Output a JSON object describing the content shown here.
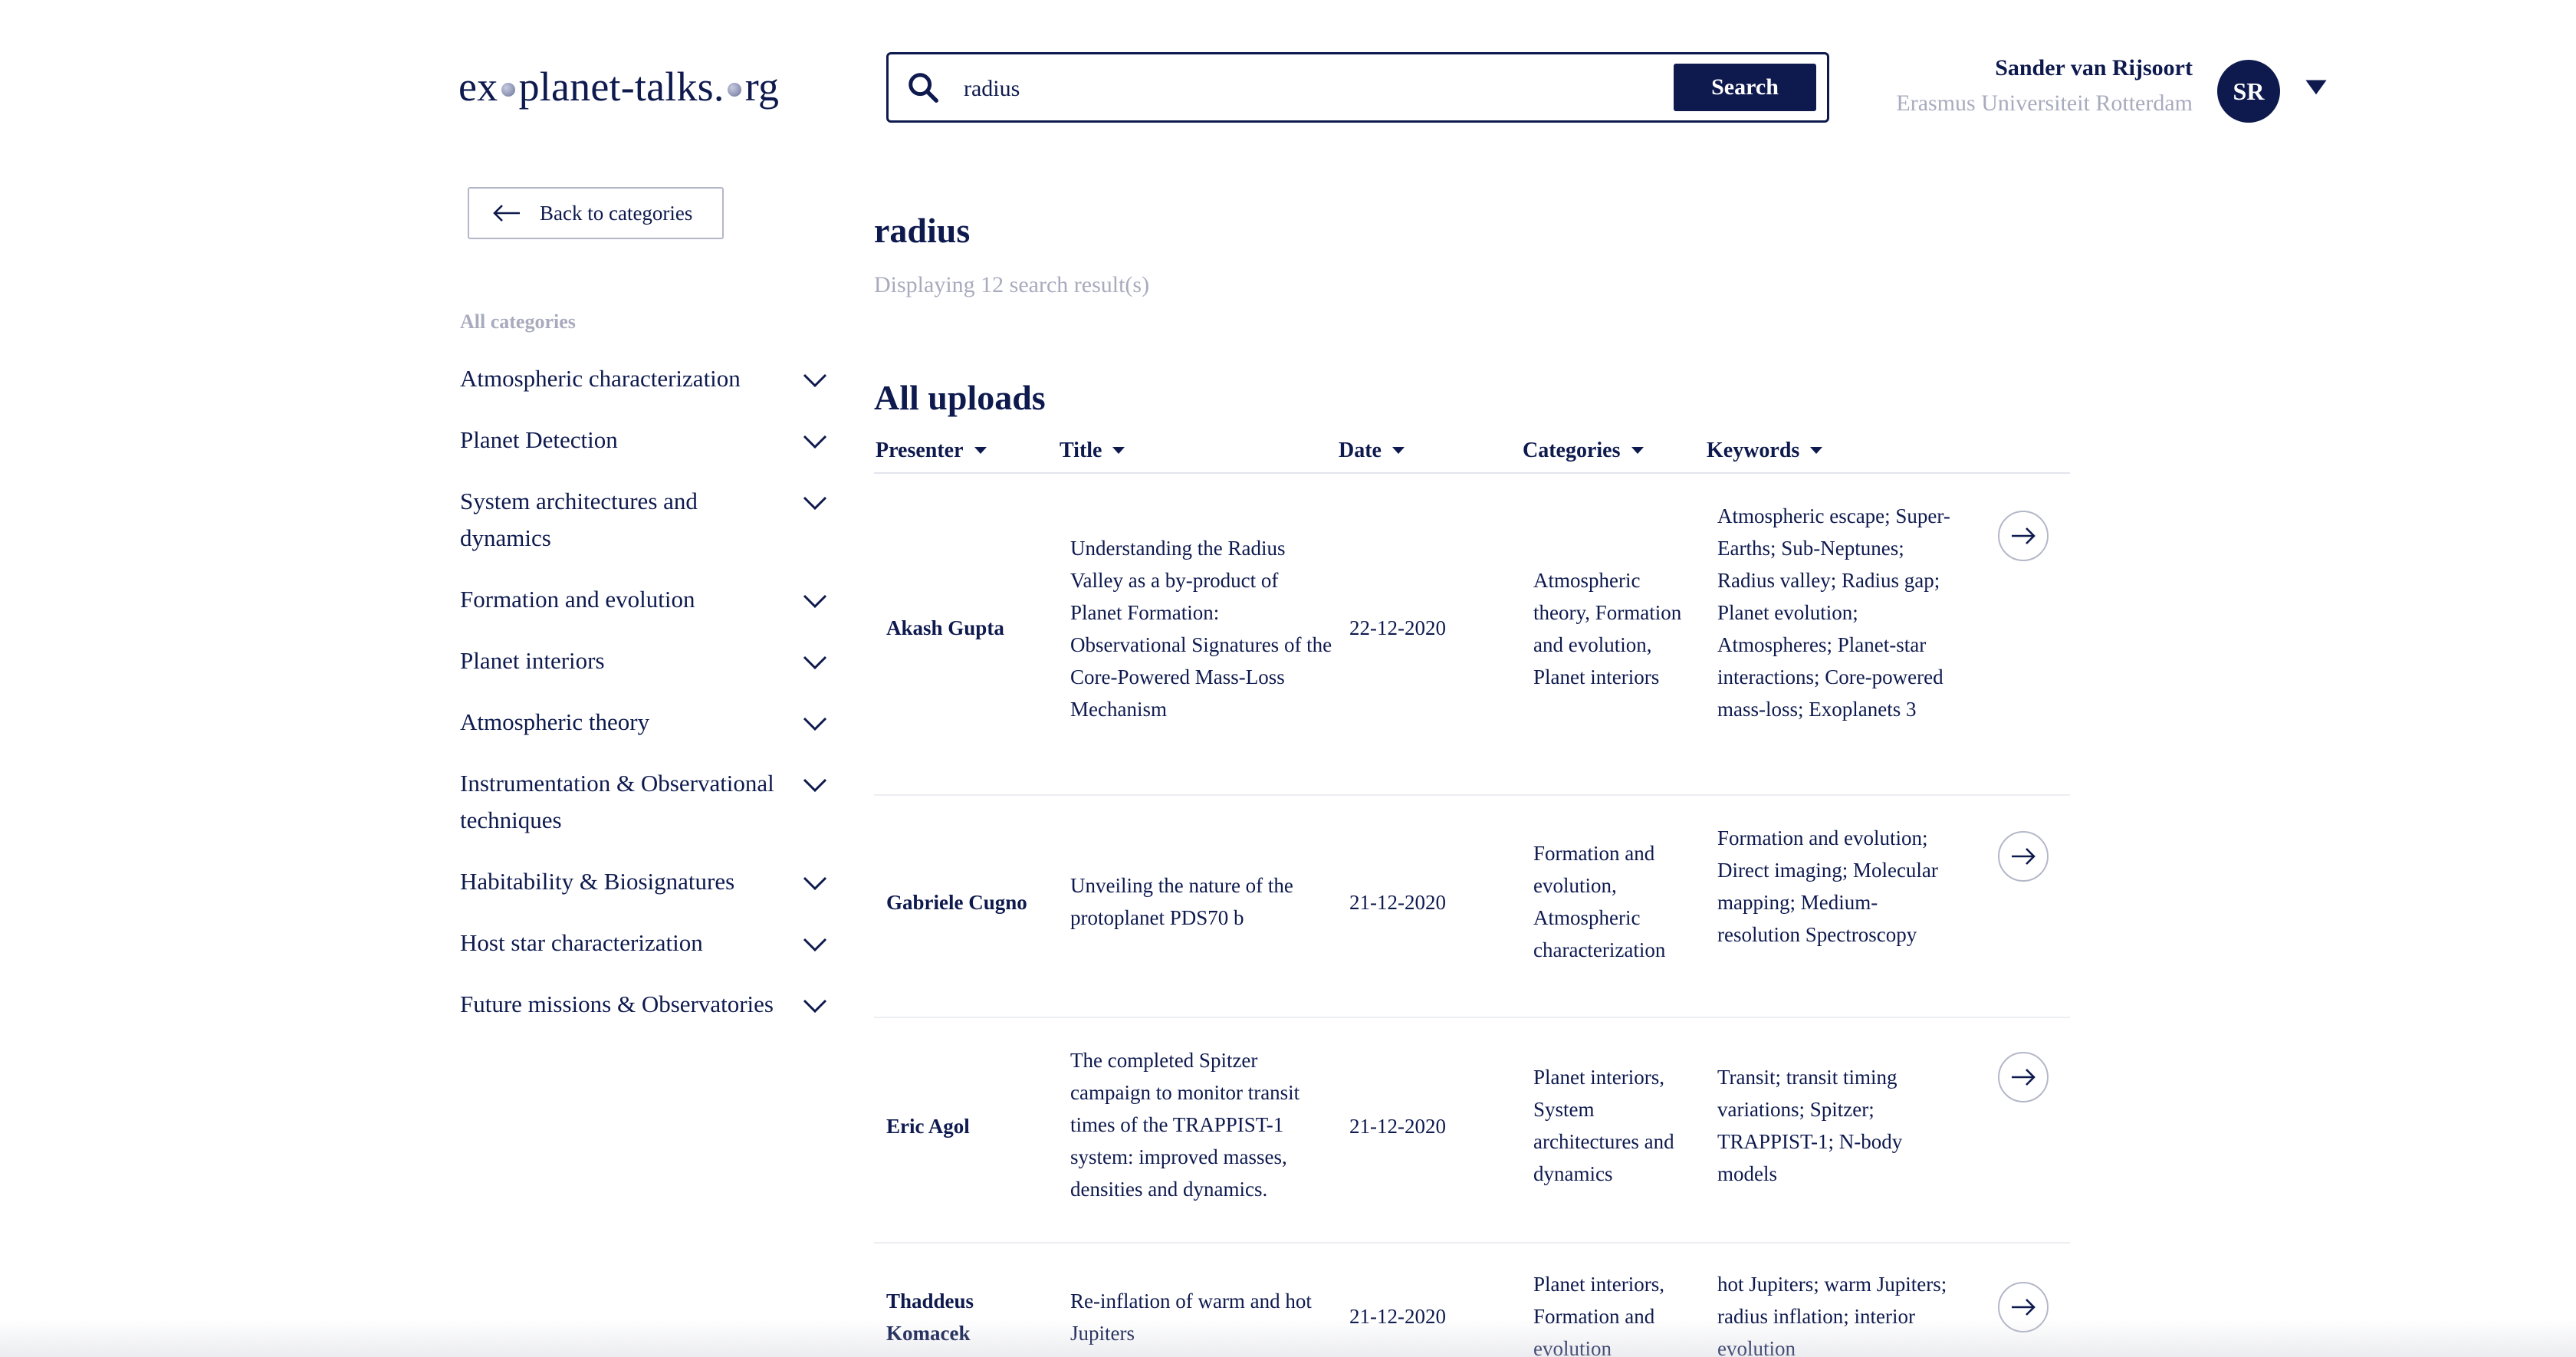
{
  "header": {
    "logo_pre": "ex",
    "logo_o1": "o",
    "logo_mid": "planet-talks.",
    "logo_o2": "o",
    "logo_post": "rg",
    "search_value": "radius",
    "search_button": "Search",
    "user_name": "Sander van Rijsoort",
    "user_org": "Erasmus Universiteit Rotterdam",
    "avatar_initials": "SR"
  },
  "sidebar": {
    "back_label": "Back to categories",
    "heading": "All categories",
    "categories": [
      "Atmospheric characterization",
      "Planet Detection",
      "System architectures and dynamics",
      "Formation and evolution",
      "Planet interiors",
      "Atmospheric theory",
      "Instrumentation & Observational techniques",
      "Habitability & Biosignatures",
      "Host star characterization",
      "Future missions & Observatories"
    ]
  },
  "main": {
    "query": "radius",
    "results_text": "Displaying 12 search result(s)",
    "uploads_heading": "All uploads",
    "columns": [
      "Presenter",
      "Title",
      "Date",
      "Categories",
      "Keywords"
    ],
    "rows": [
      {
        "presenter": "Akash Gupta",
        "title": "Understanding the Radius Valley as a by-product of Planet Formation: Observational Signatures of the Core-Powered Mass-Loss Mechanism",
        "date": "22-12-2020",
        "categories": "Atmospheric theory, Formation and evolution, Planet interiors",
        "keywords": "Atmospheric escape; Super-Earths; Sub-Neptunes; Radius valley; Radius gap; Planet evolution; Atmospheres; Planet-star interactions; Core-powered mass-loss; Exoplanets 3"
      },
      {
        "presenter": "Gabriele Cugno",
        "title": "Unveiling the nature of the protoplanet PDS70 b",
        "date": "21-12-2020",
        "categories": "Formation and evolution, Atmospheric characterization",
        "keywords": "Formation and evolution; Direct imaging; Molecular mapping; Medium-resolution Spectroscopy"
      },
      {
        "presenter": "Eric Agol",
        "title": "The completed Spitzer campaign to monitor transit times of the TRAPPIST-1 system: improved masses, densities and dynamics.",
        "date": "21-12-2020",
        "categories": "Planet interiors, System architectures and dynamics",
        "keywords": "Transit; transit timing variations; Spitzer; TRAPPIST-1; N-body models"
      },
      {
        "presenter": "Thaddeus Komacek",
        "title": "Re-inflation of warm and hot Jupiters",
        "date": "21-12-2020",
        "categories": "Planet interiors, Formation and evolution",
        "keywords": "hot Jupiters; warm Jupiters; radius inflation; interior evolution"
      }
    ]
  }
}
